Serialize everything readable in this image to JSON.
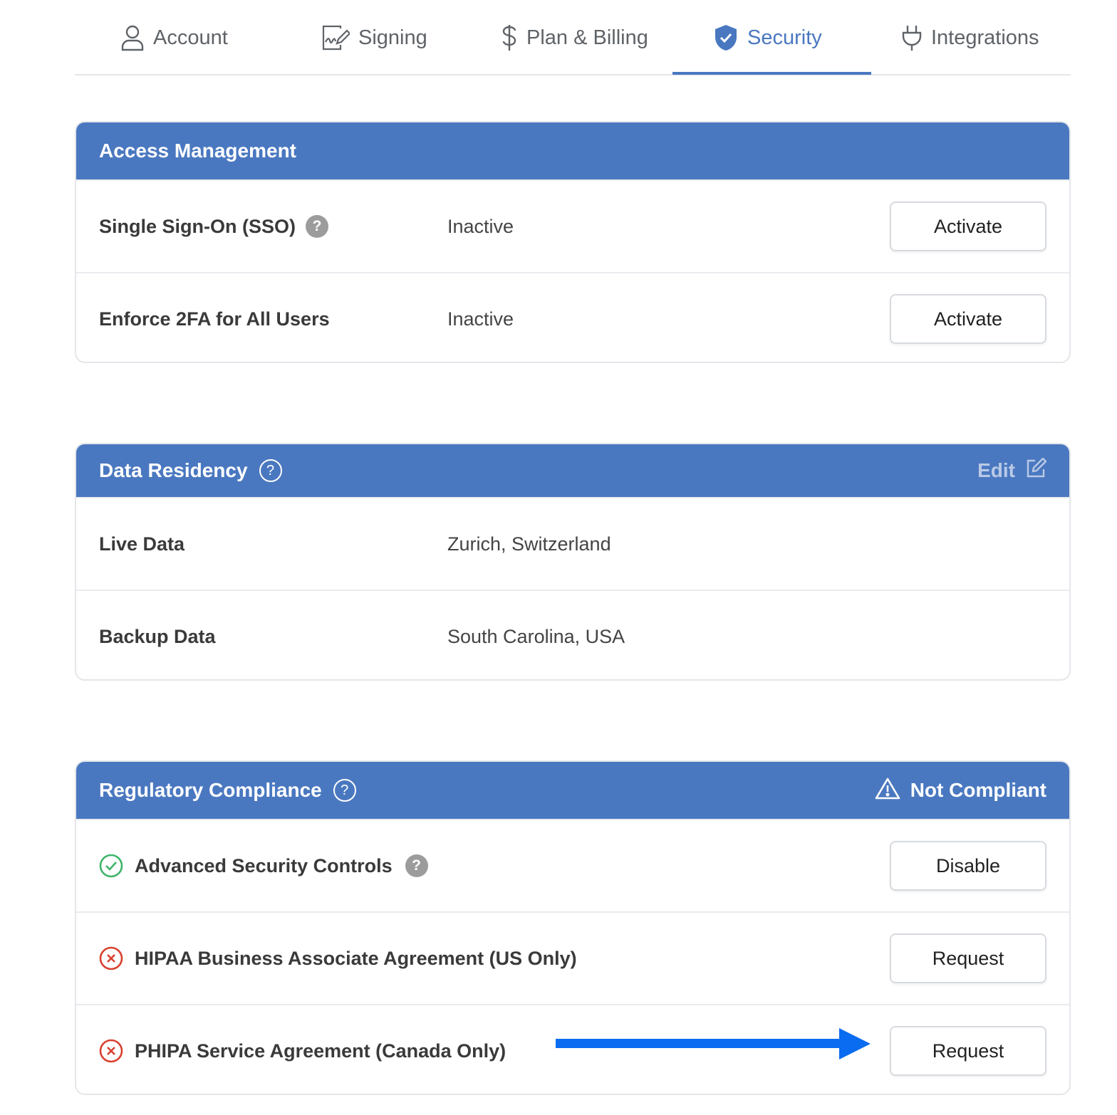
{
  "tabs": [
    {
      "label": "Account",
      "icon": "user-icon",
      "active": false
    },
    {
      "label": "Signing",
      "icon": "signature-icon",
      "active": false
    },
    {
      "label": "Plan & Billing",
      "icon": "dollar-icon",
      "active": false
    },
    {
      "label": "Security",
      "icon": "shield-check-icon",
      "active": true
    },
    {
      "label": "Integrations",
      "icon": "plug-icon",
      "active": false
    }
  ],
  "access": {
    "title": "Access Management",
    "rows": [
      {
        "label": "Single Sign-On (SSO)",
        "help": "?",
        "status": "Inactive",
        "action": "Activate"
      },
      {
        "label": "Enforce 2FA for All Users",
        "status": "Inactive",
        "action": "Activate"
      }
    ]
  },
  "residency": {
    "title": "Data Residency",
    "help": "?",
    "edit_label": "Edit",
    "rows": [
      {
        "label": "Live Data",
        "value": "Zurich, Switzerland"
      },
      {
        "label": "Backup Data",
        "value": "South Carolina, USA"
      }
    ]
  },
  "compliance": {
    "title": "Regulatory Compliance",
    "help": "?",
    "status": "Not Compliant",
    "rows": [
      {
        "label": "Advanced Security Controls",
        "help": "?",
        "state": "ok",
        "action": "Disable"
      },
      {
        "label": "HIPAA Business Associate Agreement (US Only)",
        "state": "missing",
        "action": "Request"
      },
      {
        "label": "PHIPA Service Agreement (Canada Only)",
        "state": "missing",
        "action": "Request"
      }
    ]
  },
  "colors": {
    "accent": "#4a78c0",
    "ok": "#3fb56a",
    "error": "#d8412f",
    "annotation_arrow": "#0a6cf0"
  }
}
